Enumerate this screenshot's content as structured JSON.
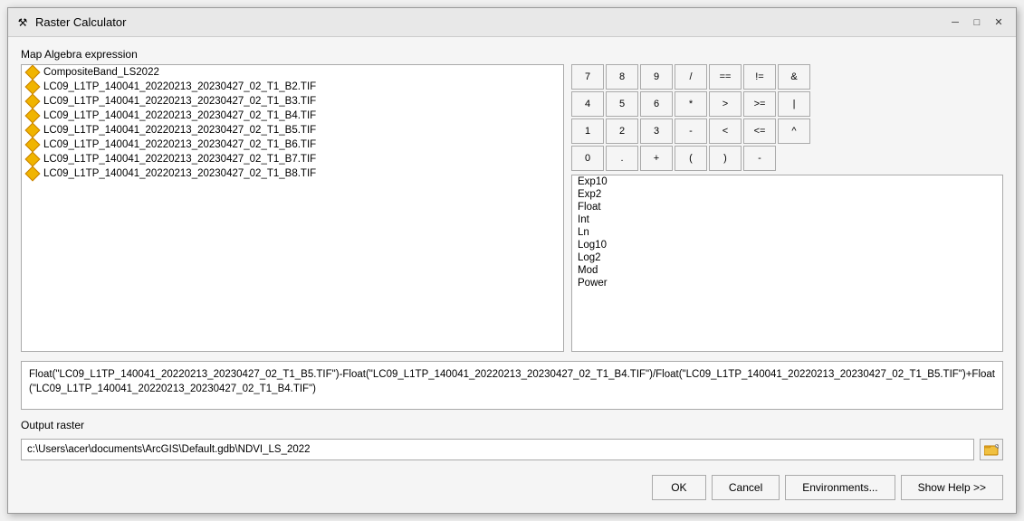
{
  "window": {
    "title": "Raster Calculator",
    "icon": "⚒"
  },
  "titlebar": {
    "minimize": "─",
    "maximize": "□",
    "close": "✕"
  },
  "sections": {
    "mapAlgebra": "Map Algebra expression",
    "outputRaster": "Output raster"
  },
  "rasterList": [
    "CompositeBand_LS2022",
    "LC09_L1TP_140041_20220213_20230427_02_T1_B2.TIF",
    "LC09_L1TP_140041_20220213_20230427_02_T1_B3.TIF",
    "LC09_L1TP_140041_20220213_20230427_02_T1_B4.TIF",
    "LC09_L1TP_140041_20220213_20230427_02_T1_B5.TIF",
    "LC09_L1TP_140041_20220213_20230427_02_T1_B6.TIF",
    "LC09_L1TP_140041_20220213_20230427_02_T1_B7.TIF",
    "LC09_L1TP_140041_20220213_20230427_02_T1_B8.TIF"
  ],
  "calcButtons": {
    "row1": [
      "7",
      "8",
      "9",
      "/",
      "==",
      "!=",
      "&"
    ],
    "row2": [
      "4",
      "5",
      "6",
      "*",
      ">",
      ">=",
      "|"
    ],
    "row3": [
      "1",
      "2",
      "3",
      "-",
      "<",
      "<=",
      "^"
    ],
    "row4": [
      "0",
      ".",
      "+",
      "(",
      ")",
      "-"
    ]
  },
  "calcButtonsFlat": [
    "7",
    "8",
    "9",
    "/",
    "==",
    "!=",
    "&",
    "4",
    "5",
    "6",
    "*",
    ">",
    ">=",
    "|",
    "1",
    "2",
    "3",
    "-",
    "<",
    "<=",
    "^",
    "0",
    ".",
    "+",
    " (",
    " )",
    "~"
  ],
  "functions": [
    "Exp10",
    "Exp2",
    "Float",
    "Int",
    "Ln",
    "Log10",
    "Log2",
    "Mod",
    "Power"
  ],
  "expression": "Float(\"LC09_L1TP_140041_20220213_20230427_02_T1_B5.TIF\")-Float(\"LC09_L1TP_140041_20220213_20230427_02_T1_B4.TIF\")/Float(\"LC09_L1TP_140041_20220213_20230427_02_T1_B5.TIF\")+Float(\"LC09_L1TP_140041_20220213_20230427_02_T1_B4.TIF\")",
  "outputPath": "c:\\Users\\acer\\documents\\ArcGIS\\Default.gdb\\NDVI_LS_2022",
  "buttons": {
    "ok": "OK",
    "cancel": "Cancel",
    "environments": "Environments...",
    "showHelp": "Show Help >>"
  }
}
